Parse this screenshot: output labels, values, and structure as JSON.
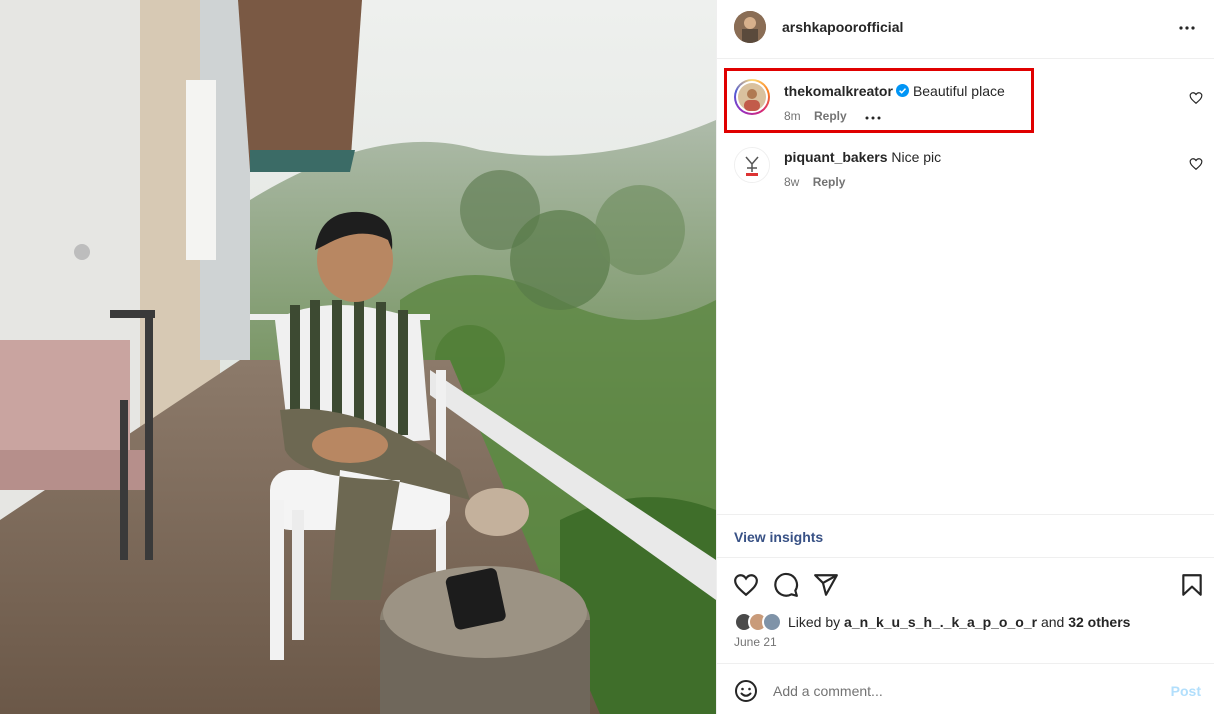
{
  "post": {
    "author": "arshkapoorofficial",
    "more_icon": "more-horizontal-icon",
    "photo_description_icon": "post-photo"
  },
  "comments": [
    {
      "username": "thekomalkreator",
      "verified": true,
      "text": "Beautiful place",
      "time": "8m",
      "reply_label": "Reply",
      "has_options": true
    },
    {
      "username": "piquant_bakers",
      "verified": false,
      "text": "Nice pic",
      "time": "8w",
      "reply_label": "Reply",
      "has_options": false
    }
  ],
  "insights": {
    "label": "View insights"
  },
  "actions": {
    "like_icon": "heart-icon",
    "comment_icon": "comment-icon",
    "share_icon": "send-icon",
    "save_icon": "bookmark-icon"
  },
  "likes": {
    "prefix": "Liked by",
    "user": "a_n_k_u_s_h_._k_a_p_o_o_r",
    "and": "and",
    "others": "32 others"
  },
  "date": "June 21",
  "comment_input": {
    "placeholder": "Add a comment...",
    "post_label": "Post"
  },
  "colors": {
    "accent_link": "#385185",
    "verified_blue": "#0095f6",
    "post_disabled": "#b2dffc",
    "highlight_red": "#e00000"
  }
}
